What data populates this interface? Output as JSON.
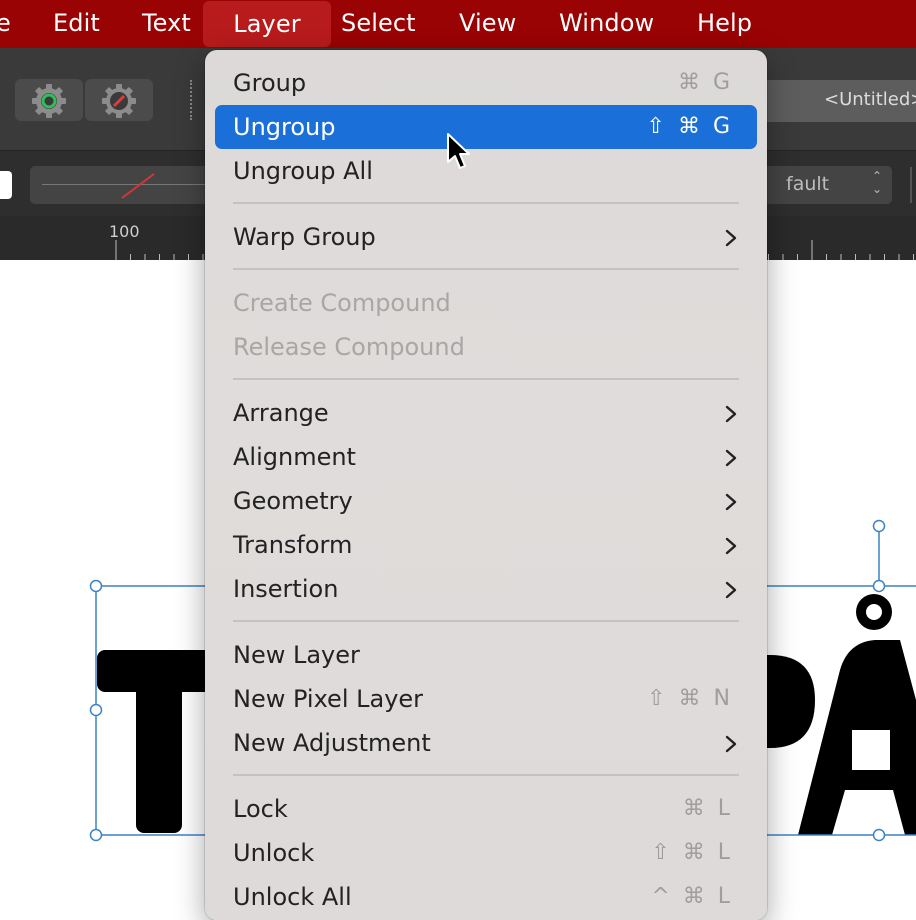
{
  "menubar": {
    "items": [
      {
        "label": "e"
      },
      {
        "label": "Edit"
      },
      {
        "label": "Text"
      },
      {
        "label": "Layer"
      },
      {
        "label": "Select"
      },
      {
        "label": "View"
      },
      {
        "label": "Window"
      },
      {
        "label": "Help"
      }
    ],
    "active": "Layer"
  },
  "toolbar": {
    "document_title": "<Untitled>"
  },
  "context_toolbar": {
    "style_value": "fault"
  },
  "ruler": {
    "label": "100"
  },
  "canvas": {
    "text_left": "T",
    "text_right": "PÅ"
  },
  "layer_menu": {
    "items": [
      {
        "label": "Group",
        "shortcut": "⌘ G",
        "state": "normal"
      },
      {
        "label": "Ungroup",
        "shortcut": "⇧ ⌘ G",
        "state": "highlighted"
      },
      {
        "label": "Ungroup All",
        "shortcut": "",
        "state": "normal"
      },
      {
        "label": "Warp Group",
        "submenu": true,
        "state": "normal"
      },
      {
        "label": "Create Compound",
        "state": "disabled"
      },
      {
        "label": "Release Compound",
        "state": "disabled"
      },
      {
        "label": "Arrange",
        "submenu": true,
        "state": "normal"
      },
      {
        "label": "Alignment",
        "submenu": true,
        "state": "normal"
      },
      {
        "label": "Geometry",
        "submenu": true,
        "state": "normal"
      },
      {
        "label": "Transform",
        "submenu": true,
        "state": "normal"
      },
      {
        "label": "Insertion",
        "submenu": true,
        "state": "normal"
      },
      {
        "label": "New Layer",
        "state": "normal"
      },
      {
        "label": "New Pixel Layer",
        "shortcut": "⇧ ⌘ N",
        "state": "normal"
      },
      {
        "label": "New Adjustment",
        "submenu": true,
        "state": "normal"
      },
      {
        "label": "Lock",
        "shortcut": "⌘ L",
        "state": "normal"
      },
      {
        "label": "Unlock",
        "shortcut": "⇧ ⌘ L",
        "state": "normal"
      },
      {
        "label": "Unlock All",
        "shortcut": "^ ⌘ L",
        "state": "normal"
      }
    ]
  },
  "colors": {
    "menubar": "#9a0303",
    "highlight": "#1a6fd8",
    "selection": "#3b82c4"
  }
}
